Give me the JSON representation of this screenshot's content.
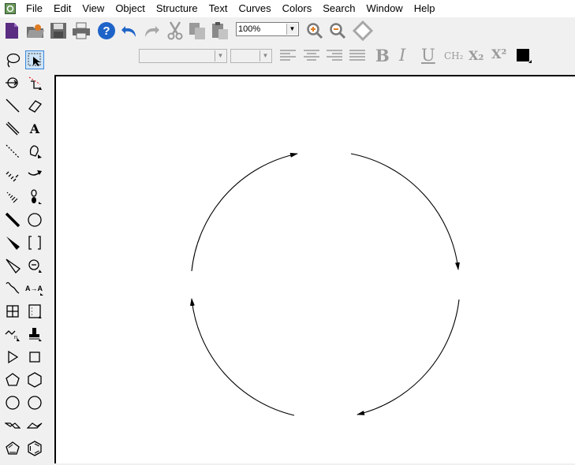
{
  "menubar": {
    "items": [
      {
        "label": "File"
      },
      {
        "label": "Edit"
      },
      {
        "label": "View"
      },
      {
        "label": "Object"
      },
      {
        "label": "Structure"
      },
      {
        "label": "Text"
      },
      {
        "label": "Curves"
      },
      {
        "label": "Colors"
      },
      {
        "label": "Search"
      },
      {
        "label": "Window"
      },
      {
        "label": "Help"
      }
    ]
  },
  "toolbar": {
    "zoom_value": "100%",
    "font_name": "",
    "font_size": "",
    "icons": [
      "new-document-icon",
      "open-icon",
      "save-icon",
      "print-icon",
      "help-icon",
      "undo-icon",
      "redo-icon",
      "cut-icon",
      "copy-icon",
      "paste-icon",
      "zoom-in-icon",
      "zoom-out-icon",
      "clean-structure-icon"
    ]
  },
  "format_bar": {
    "bold": "B",
    "italic": "I",
    "underline": "U",
    "formula": "CH₂",
    "subscript": "X₂",
    "superscript": "X²",
    "color": "#000000"
  },
  "tools": [
    "lasso-icon",
    "marquee-select-icon",
    "mass-fragment-icon",
    "eraser-cut-icon",
    "solid-bond-icon",
    "eraser-icon",
    "double-bond-icon",
    "text-icon",
    "dashed-bond-icon",
    "pen-icon",
    "hashed-bond-icon",
    "arrow-tool-icon",
    "hashed-wedge-icon",
    "orbital-icon",
    "bold-bond-icon",
    "circle-icon",
    "wedge-bond-icon",
    "bracket-icon",
    "hollow-wedge-icon",
    "charge-icon",
    "wavy-bond-icon",
    "atom-map-icon",
    "table-icon",
    "tlc-plate-icon",
    "chain-icon",
    "stamp-icon",
    "triangle-icon",
    "square-icon",
    "pentagon-icon",
    "hexagon-icon",
    "heptagon-icon",
    "octagon-icon",
    "chair-cyclohexane-icon",
    "chair-cyclohexane-alt-icon",
    "cyclopentadiene-icon",
    "benzene-icon"
  ]
}
